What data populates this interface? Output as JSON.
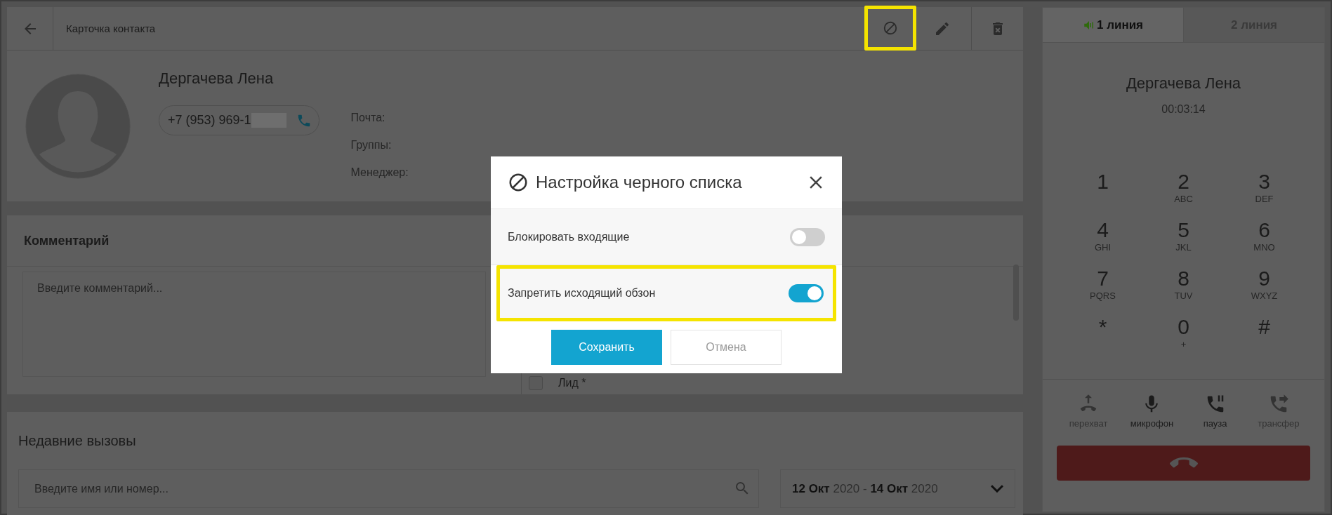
{
  "header": {
    "title": "Карточка контакта",
    "actions": [
      {
        "highlighted": true
      },
      {
        "highlighted": false
      },
      {
        "highlighted": false
      }
    ]
  },
  "contact": {
    "name": "Дергачева Лена",
    "phone": "+7 (953) 969-1",
    "phone_redacted": true,
    "fields": [
      "Почта:",
      "Группы:",
      "Менеджер:"
    ]
  },
  "comment": {
    "title": "Комментарий",
    "placeholder": "Введите комментарий...",
    "tags": [
      {
        "label": "Лид *",
        "checked": false
      }
    ]
  },
  "recent_calls": {
    "title": "Недавние вызовы",
    "search_placeholder": "Введите имя или номер...",
    "date_range": {
      "from_day": "12 Окт",
      "from_year": "2020",
      "separator": "-",
      "to_day": "14 Окт",
      "to_year": "2020"
    }
  },
  "phone": {
    "lines": [
      {
        "label": "1 линия",
        "selected": true,
        "speaker": true
      },
      {
        "label": "2 линия",
        "selected": false,
        "speaker": false
      }
    ],
    "caller": "Дергачева Лена",
    "duration": "00:03:14",
    "keys": [
      {
        "digit": "1"
      },
      {
        "digit": "2",
        "letters": "ABC"
      },
      {
        "digit": "3",
        "letters": "DEF"
      },
      {
        "digit": "4",
        "letters": "GHI"
      },
      {
        "digit": "5",
        "letters": "JKL"
      },
      {
        "digit": "6",
        "letters": "MNO"
      },
      {
        "digit": "7",
        "letters": "PQRS"
      },
      {
        "digit": "8",
        "letters": "TUV"
      },
      {
        "digit": "9",
        "letters": "WXYZ"
      },
      {
        "digit": "*"
      },
      {
        "digit": "0",
        "letters": "+"
      },
      {
        "digit": "#"
      }
    ],
    "actions": [
      {
        "label": "перехват",
        "disabled": true
      },
      {
        "label": "микрофон",
        "disabled": false
      },
      {
        "label": "пауза",
        "disabled": false
      },
      {
        "label": "трансфер",
        "disabled": true
      }
    ]
  },
  "modal": {
    "title": "Настройка черного списка",
    "options": [
      {
        "label": "Блокировать входящие",
        "on": false,
        "highlighted": false
      },
      {
        "label": "Запретить исходящий обзон",
        "on": true,
        "highlighted": true
      }
    ],
    "buttons": [
      {
        "label": "Сохранить",
        "kind": "primary"
      },
      {
        "label": "Отмена",
        "kind": "secondary"
      }
    ]
  }
}
